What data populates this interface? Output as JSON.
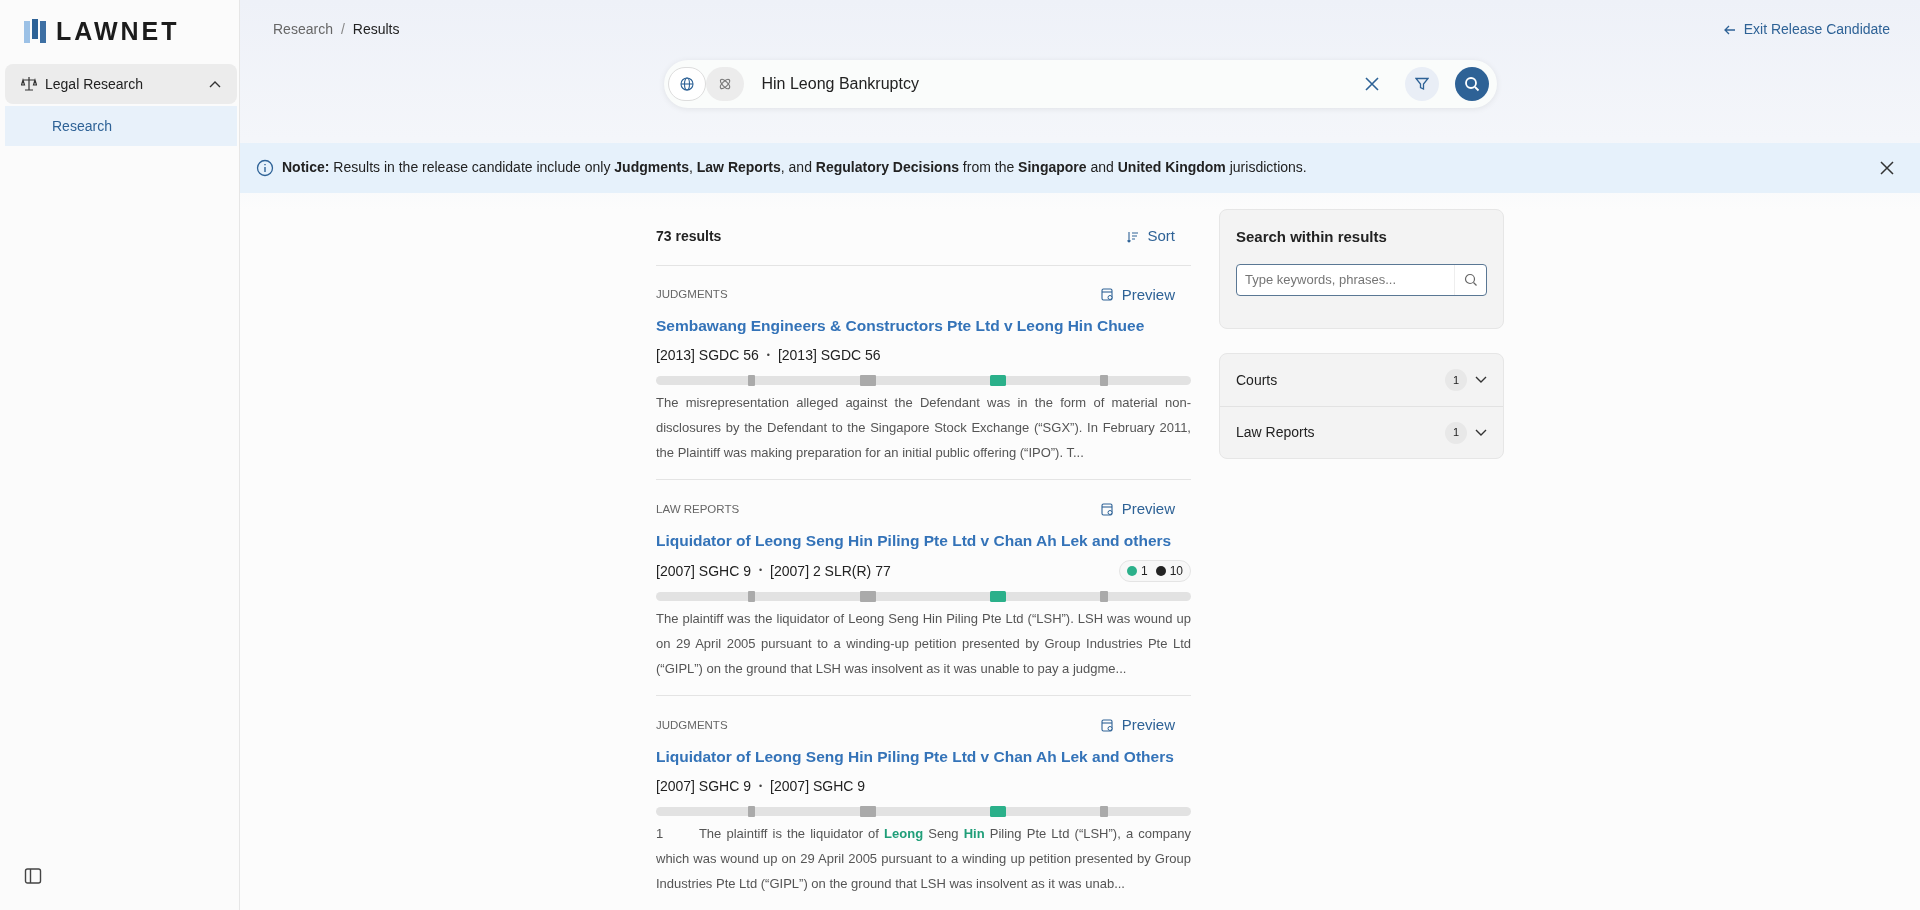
{
  "brand": {
    "name": "LAWNET"
  },
  "sidebar": {
    "items": [
      {
        "label": "Legal Research",
        "expanded": true,
        "children": [
          {
            "label": "Research",
            "selected": true
          }
        ]
      }
    ]
  },
  "breadcrumb": {
    "separator": "/",
    "items": [
      {
        "label": "Research"
      },
      {
        "label": "Results"
      }
    ]
  },
  "exit_link": {
    "label": "Exit Release Candidate"
  },
  "search": {
    "modes": [
      {
        "kind": "globe",
        "selected": true
      },
      {
        "kind": "atom",
        "selected": false
      }
    ],
    "value": "Hin Leong Bankruptcy"
  },
  "notice": {
    "text": "**Notice:** Results in the release candidate include only **Judgments**, **Law Reports**, and **Regulatory Decisions** from the **Singapore** and **United Kingdom** jurisdictions."
  },
  "results": {
    "count": "73 results",
    "sort_label": "Sort",
    "items": [
      {
        "category": "JUDGMENTS",
        "preview": "Preview",
        "title": "Sembawang Engineers & Constructors Pte Ltd v Leong Hin Chuee",
        "citations": [
          "[2013] SGDC 56",
          "[2013] SGDC 56"
        ],
        "separator": "•",
        "snippet": "The misrepresentation alleged against the Defendant was in the form of material non-disclosures by the Defendant to the Singapore Stock Exchange (“SGX”). In February 2011, the Plaintiff was making preparation for an initial public offering (“IPO”). T..."
      },
      {
        "category": "LAW REPORTS",
        "preview": "Preview",
        "title": "Liquidator of Leong Seng Hin Piling Pte Ltd v Chan Ah Lek and others",
        "citations": [
          "[2007] SGHC 9",
          "[2007] 2 SLR(R) 77"
        ],
        "separator": "•",
        "counts": [
          {
            "value": "1",
            "color": "#2bb08a"
          },
          {
            "value": "10",
            "color": "#222222"
          }
        ],
        "snippet": "The plaintiff was the liquidator of Leong Seng Hin Piling Pte Ltd (“LSH”). LSH was wound up on 29 April 2005 pursuant to a winding-up petition presented by Group Industries Pte Ltd (“GIPL”) on the ground that LSH was insolvent as it was unable to pay a judgme..."
      },
      {
        "category": "JUDGMENTS",
        "preview": "Preview",
        "title": "Liquidator of Leong Seng Hin Piling Pte Ltd v Chan Ah Lek and Others",
        "citations": [
          "[2007] SGHC 9",
          "[2007] SGHC 9"
        ],
        "separator": "•",
        "snippet": "1       The plaintiff is the liquidator of **Leong** Seng **Hin** Piling Pte Ltd (“LSH”), a company which was wound up on 29 April 2005 pursuant to a winding up petition presented by Group Industries Pte Ltd (“GIPL”) on the ground that LSH was insolvent as it was unab..."
      }
    ]
  },
  "within": {
    "title": "Search within results",
    "placeholder": "Type keywords, phrases..."
  },
  "facets": [
    {
      "label": "Courts",
      "count": "1",
      "expanded": false
    },
    {
      "label": "Law Reports",
      "count": "1",
      "expanded": false
    }
  ]
}
